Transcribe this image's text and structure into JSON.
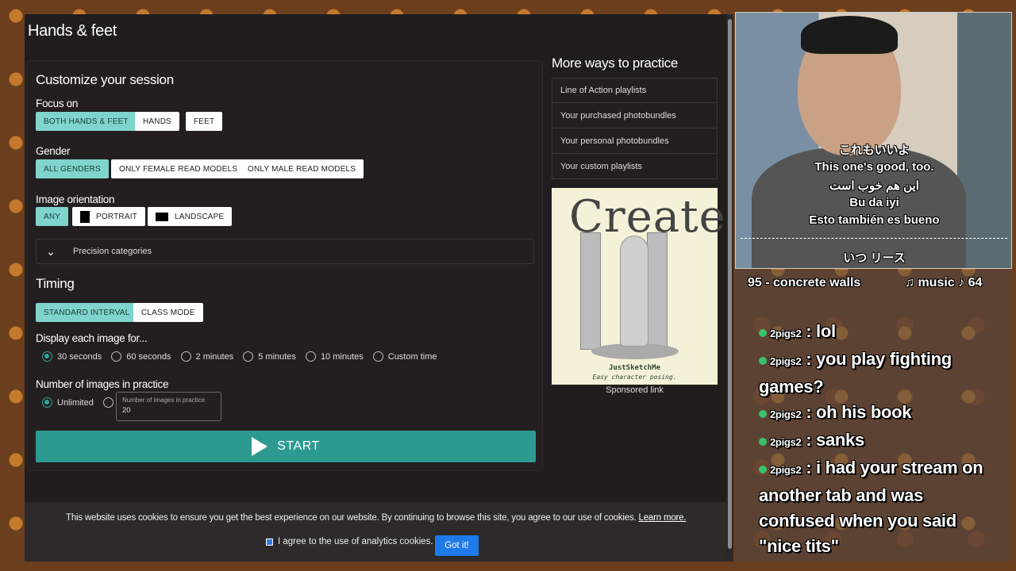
{
  "page": {
    "title": "Hands & feet"
  },
  "session": {
    "heading": "Customize your session",
    "focus": {
      "label": "Focus on",
      "options": [
        "BOTH HANDS & FEET",
        "HANDS",
        "FEET"
      ]
    },
    "gender": {
      "label": "Gender",
      "options": [
        "ALL GENDERS",
        "ONLY FEMALE READ MODELS",
        "ONLY MALE READ MODELS"
      ]
    },
    "orientation": {
      "label": "Image orientation",
      "options": [
        "ANY",
        "PORTRAIT",
        "LANDSCAPE"
      ]
    },
    "precision_label": "Precision categories"
  },
  "timing": {
    "heading": "Timing",
    "modes": [
      "STANDARD INTERVAL",
      "CLASS MODE"
    ],
    "display_label": "Display each image for...",
    "durations": [
      "30 seconds",
      "60 seconds",
      "2 minutes",
      "5 minutes",
      "10 minutes",
      "Custom time"
    ],
    "count_label": "Number of images in practice",
    "count_unlimited": "Unlimited",
    "count_field_placeholder": "Number of images in practice",
    "count_field_value": "20",
    "start_label": "START"
  },
  "sidebar": {
    "title": "More ways to practice",
    "items": [
      "Line of Action playlists",
      "Your purchased photobundles",
      "Your personal photobundles",
      "Your custom playlists"
    ],
    "ad": {
      "headline": "Create",
      "brand": "JustSketchMe",
      "tagline": "Easy character posing."
    },
    "sponsored": "Sponsored link"
  },
  "cookie": {
    "message": "This website uses cookies to ensure you get the best experience on our website. By continuing to browse this site, you agree to our use of cookies.",
    "learn_more": "Learn more.",
    "checkbox_label": "I agree to the use of analytics cookies.",
    "accept": "Got it!"
  },
  "stream": {
    "captions": [
      "これもいいよ",
      "This one's good, too.",
      "این هم خوب است",
      "Bu da iyi",
      "Esto también es bueno"
    ],
    "bottom_caption": "いつ リース",
    "ticker_left": "95 - concrete walls",
    "ticker_right": "♫ music ♪ 64",
    "chat": [
      {
        "user": "2pigs2",
        "text": "lol"
      },
      {
        "user": "2pigs2",
        "text": "you play fighting games?"
      },
      {
        "user": "2pigs2",
        "text": "oh his book"
      },
      {
        "user": "2pigs2",
        "text": "sanks"
      },
      {
        "user": "2pigs2",
        "text": "i had your stream on another tab and was confused when you said \"nice tits\""
      }
    ]
  },
  "colors": {
    "accent": "#2d9a92",
    "active_chip": "#7fd4cd",
    "cookie_button": "#1e7ae8"
  }
}
